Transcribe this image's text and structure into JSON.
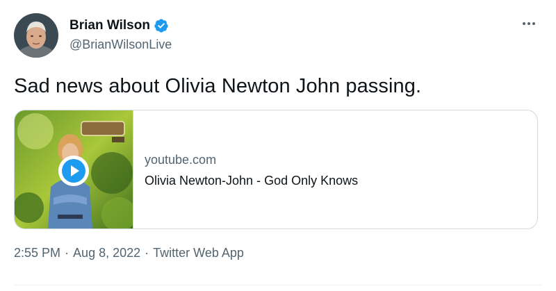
{
  "author": {
    "display_name": "Brian Wilson",
    "handle": "@BrianWilsonLive",
    "verified": true
  },
  "tweet": {
    "text": "Sad news about Olivia Newton John passing."
  },
  "link_card": {
    "domain": "youtube.com",
    "title": "Olivia Newton-John - God Only Knows",
    "thumbnail_icon": "play-icon"
  },
  "meta": {
    "time": "2:55 PM",
    "separator": "·",
    "date": "Aug 8, 2022",
    "source": "Twitter Web App"
  },
  "colors": {
    "verified_blue": "#1d9bf0",
    "text_primary": "#0f1419",
    "text_secondary": "#536471",
    "border": "#cfd9de"
  }
}
